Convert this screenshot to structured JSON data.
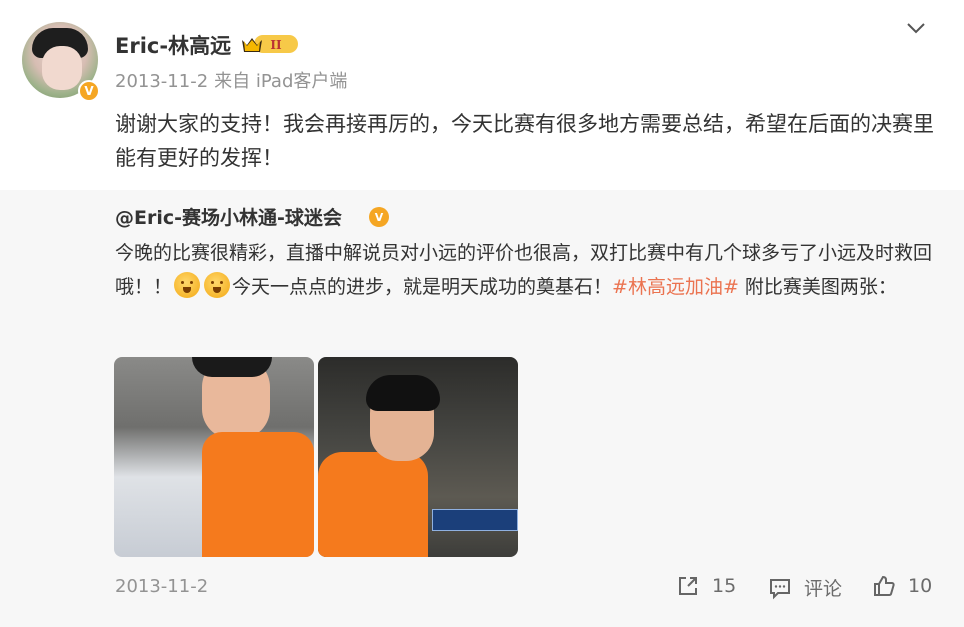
{
  "post": {
    "username": "Eric-林高远",
    "date": "2013-11-2",
    "source": "来自 iPad客户端",
    "text": "谢谢大家的支持！我会再接再厉的，今天比赛有很多地方需要总结，希望在后面的决赛里能有更好的发挥！",
    "verified_mark": "V",
    "member_level": "II"
  },
  "repost": {
    "username": "@Eric-赛场小林通-球迷会",
    "verified_mark": "V",
    "text_part1": "今晚的比赛很精彩，直播中解说员对小远的评价也很高，双打比赛中有几个球多亏了小远及时救回哦！！",
    "text_part2": "今天一点点的进步，就是明天成功的奠基石！",
    "hashtag": "#林高远加油#",
    "text_part3": " 附比赛美图两张：",
    "images": [
      {
        "label": "table-tennis-photo-1"
      },
      {
        "label": "table-tennis-photo-2"
      }
    ]
  },
  "footer": {
    "date": "2013-11-2",
    "share_count": "15",
    "comment_label": "评论",
    "like_count": "10"
  },
  "colors": {
    "accent": "#eb7350",
    "badge": "#f5a623",
    "muted": "#939393",
    "repost_bg": "#f7f7f7"
  },
  "icons": [
    "chevron-down-icon",
    "share-icon",
    "comment-icon",
    "like-icon",
    "verified-icon",
    "member-badge-icon"
  ]
}
